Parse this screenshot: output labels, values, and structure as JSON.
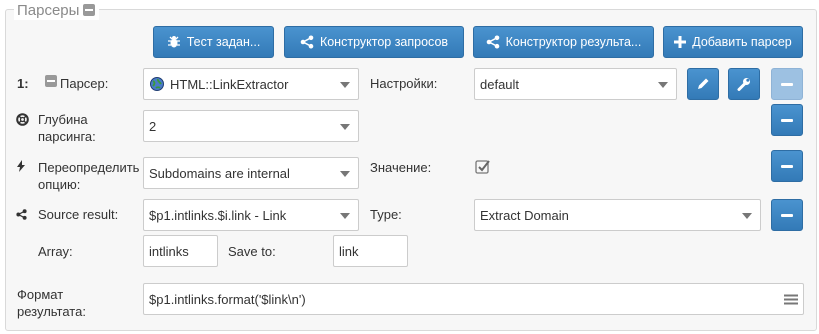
{
  "legend": {
    "title": "Парсеры"
  },
  "toolbar": {
    "test_task": "Тест задан...",
    "query_builder": "Конструктор запросов",
    "result_builder": "Конструктор результа...",
    "add_parser": "Добавить парсер"
  },
  "row1": {
    "index": "1:",
    "parser_label": "Парсер:",
    "parser_value": "HTML::LinkExtractor",
    "settings_label": "Настройки:",
    "settings_value": "default"
  },
  "depth": {
    "label_line1": "Глубина",
    "label_line2": "парсинга:",
    "value": "2"
  },
  "override": {
    "label_line1": "Переопределить",
    "label_line2": "опцию:",
    "value": "Subdomains are internal",
    "value_label": "Значение:",
    "checked": true
  },
  "source": {
    "label": "Source result:",
    "value": "$p1.intlinks.$i.link - Link",
    "type_label": "Type:",
    "type_value": "Extract Domain"
  },
  "array": {
    "label": "Array:",
    "value": "intlinks",
    "save_label": "Save to:",
    "save_value": "link"
  },
  "format": {
    "label_line1": "Формат",
    "label_line2": "результата:",
    "value": "$p1.intlinks.format('$link\\n')"
  },
  "colors": {
    "primary": "#337ab7",
    "primary_disabled": "#9dc1e2",
    "panel_bg": "#f7f7f7"
  }
}
